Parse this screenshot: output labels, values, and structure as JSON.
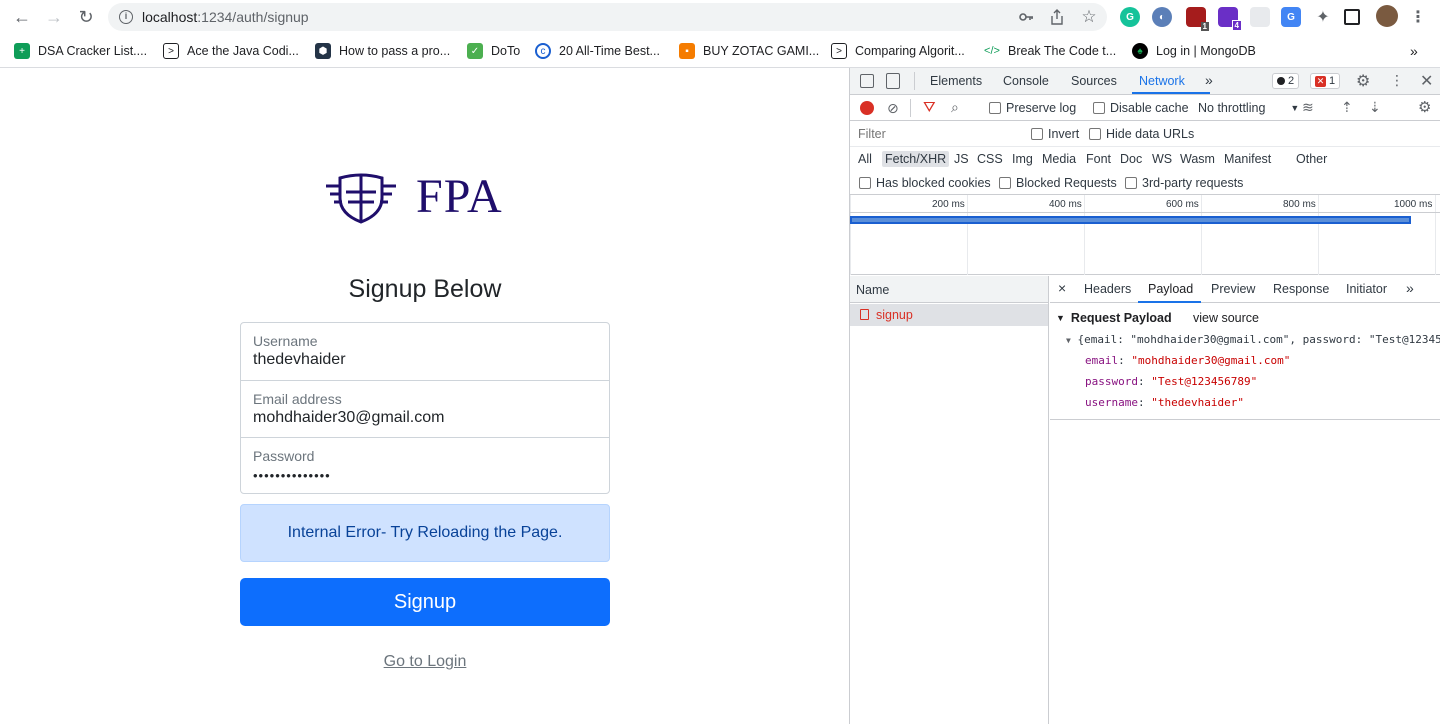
{
  "browser": {
    "url_host": "localhost",
    "url_path": ":1234/auth/signup",
    "badges": {
      "ext_count_1": "1",
      "ext_count_2": "4"
    },
    "bookmarks": [
      {
        "label": "DSA Cracker List...."
      },
      {
        "label": "Ace the Java Codi..."
      },
      {
        "label": "How to pass a pro..."
      },
      {
        "label": "DoTo"
      },
      {
        "label": "20 All-Time Best..."
      },
      {
        "label": "BUY ZOTAC GAMI..."
      },
      {
        "label": "Comparing Algorit..."
      },
      {
        "label": "Break The Code t..."
      },
      {
        "label": "Log in | MongoDB"
      }
    ],
    "more_bookmarks": "»"
  },
  "page": {
    "logo_text": "FPA",
    "title": "Signup Below",
    "fields": [
      {
        "label": "Username",
        "value": "thedevhaider"
      },
      {
        "label": "Email address",
        "value": "mohdhaider30@gmail.com"
      },
      {
        "label": "Password",
        "value": "••••••••••••••"
      }
    ],
    "alert": "Internal Error- Try Reloading the Page.",
    "submit_label": "Signup",
    "login_link": "Go to Login",
    "colors": {
      "primary": "#0d6efd",
      "alert_bg": "#cfe2ff",
      "logo": "#1f0e6b"
    }
  },
  "devtools": {
    "tabs": [
      "Elements",
      "Console",
      "Sources",
      "Network"
    ],
    "active_tab": "Network",
    "more": "»",
    "issues_count": "2",
    "errors_count": "1",
    "preserve_log": "Preserve log",
    "disable_cache": "Disable cache",
    "throttling": "No throttling",
    "filter_placeholder": "Filter",
    "invert": "Invert",
    "hide_data_urls": "Hide data URLs",
    "types": [
      "All",
      "Fetch/XHR",
      "JS",
      "CSS",
      "Img",
      "Media",
      "Font",
      "Doc",
      "WS",
      "Wasm",
      "Manifest",
      "Other"
    ],
    "active_type": "Fetch/XHR",
    "has_blocked_cookies": "Has blocked cookies",
    "blocked_requests": "Blocked Requests",
    "third_party": "3rd-party requests",
    "timeline_labels": [
      "200 ms",
      "400 ms",
      "600 ms",
      "800 ms",
      "1000 ms"
    ],
    "name_header": "Name",
    "request_name": "signup",
    "detail_tabs": [
      "Headers",
      "Payload",
      "Preview",
      "Response",
      "Initiator"
    ],
    "active_detail_tab": "Payload",
    "close": "×",
    "payload_title": "Request Payload",
    "view_source": "view source",
    "payload_summary": "{email: \"mohdhaider30@gmail.com\", password: \"Test@12345",
    "payload": [
      {
        "key": "email",
        "value": "\"mohdhaider30@gmail.com\""
      },
      {
        "key": "password",
        "value": "\"Test@123456789\""
      },
      {
        "key": "username",
        "value": "\"thedevhaider\""
      }
    ]
  }
}
